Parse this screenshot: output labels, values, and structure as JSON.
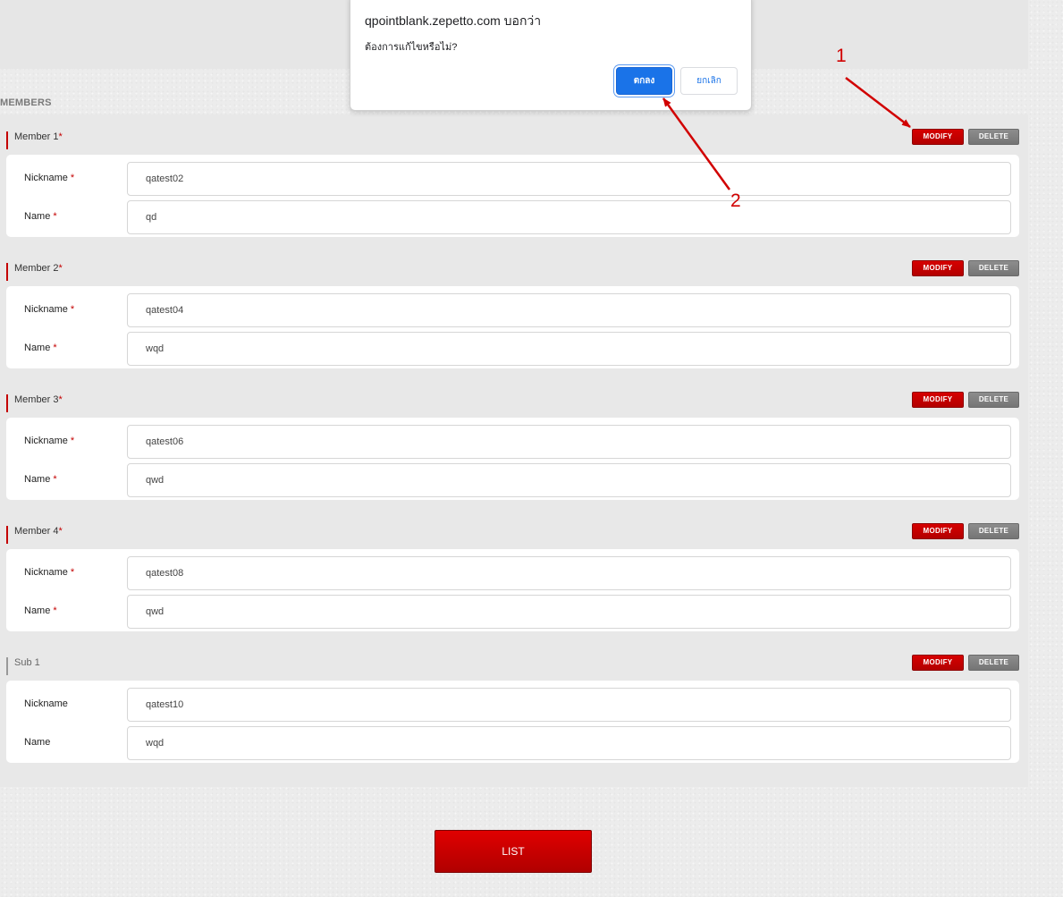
{
  "section": {
    "title": "MEMBERS"
  },
  "members": [
    {
      "title": "Member 1",
      "required_mark": "*",
      "nickname_label": "Nickname",
      "nickname_required": "*",
      "nickname_value": "qatest02",
      "name_label": "Name",
      "name_required": "*",
      "name_value": "qd",
      "modify_label": "MODIFY",
      "delete_label": "DELETE"
    },
    {
      "title": "Member 2",
      "required_mark": "*",
      "nickname_label": "Nickname",
      "nickname_required": "*",
      "nickname_value": "qatest04",
      "name_label": "Name",
      "name_required": "*",
      "name_value": "wqd",
      "modify_label": "MODIFY",
      "delete_label": "DELETE"
    },
    {
      "title": "Member 3",
      "required_mark": "*",
      "nickname_label": "Nickname",
      "nickname_required": "*",
      "nickname_value": "qatest06",
      "name_label": "Name",
      "name_required": "*",
      "name_value": "qwd",
      "modify_label": "MODIFY",
      "delete_label": "DELETE"
    },
    {
      "title": "Member 4",
      "required_mark": "*",
      "nickname_label": "Nickname",
      "nickname_required": "*",
      "nickname_value": "qatest08",
      "name_label": "Name",
      "name_required": "*",
      "name_value": "qwd",
      "modify_label": "MODIFY",
      "delete_label": "DELETE"
    },
    {
      "title": "Sub 1",
      "required_mark": "",
      "nickname_label": "Nickname",
      "nickname_required": "",
      "nickname_value": "qatest10",
      "name_label": "Name",
      "name_required": "",
      "name_value": "wqd",
      "modify_label": "MODIFY",
      "delete_label": "DELETE"
    }
  ],
  "dialog": {
    "title": "qpointblank.zepetto.com บอกว่า",
    "message": "ต้องการแก้ไขหรือไม่?",
    "ok_label": "ตกลง",
    "cancel_label": "ยกเลิก"
  },
  "footer": {
    "list_label": "LIST"
  },
  "annotations": {
    "marker_1": "1",
    "marker_2": "2",
    "color": "#d10000"
  },
  "colors": {
    "accent_red": "#c40000",
    "delete_gray": "#808080",
    "dialog_blue": "#1a73e8"
  }
}
